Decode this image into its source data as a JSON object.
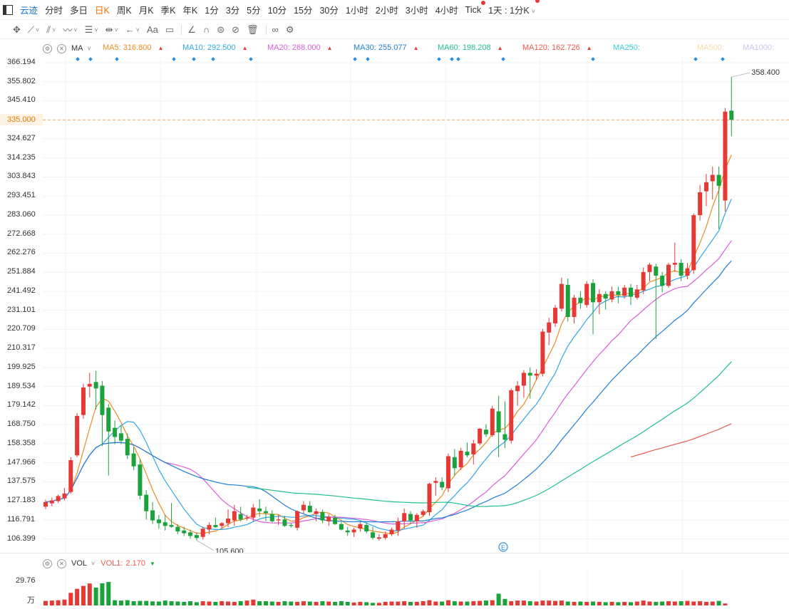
{
  "topbar": {
    "periods": [
      "云迹",
      "分时",
      "多日",
      "日K",
      "周K",
      "月K",
      "季K",
      "年K",
      "1分",
      "3分",
      "5分",
      "10分",
      "15分",
      "30分",
      "1小时",
      "2小时",
      "3小时",
      "4小时",
      "Tick",
      "1天 : 1分K"
    ],
    "active": "日K",
    "dotted": [
      "Tick",
      "1天 : 1分K"
    ]
  },
  "toolbar": {
    "tools": [
      "crosshair-icon",
      "line-icon",
      "channel-icon",
      "wave-icon",
      "fib-icon",
      "measure-icon",
      "arrow-icon",
      "text-icon",
      "comment-icon",
      "angle-icon",
      "magnet-icon",
      "hide-icon",
      "lock-icon",
      "delete-icon",
      "link-icon",
      "settings-icon"
    ],
    "text_label": "Aa"
  },
  "ma_legend": {
    "name": "MA",
    "items": [
      {
        "label": "MA5:",
        "value": "316.800",
        "color": "#f08a24",
        "trend": "up"
      },
      {
        "label": "MA10:",
        "value": "292.500",
        "color": "#2fa8e8",
        "trend": "up"
      },
      {
        "label": "MA20:",
        "value": "268.000",
        "color": "#d95ed9",
        "trend": "up"
      },
      {
        "label": "MA30:",
        "value": "255.077",
        "color": "#1e7fd9",
        "trend": "up"
      },
      {
        "label": "MA60:",
        "value": "198.208",
        "color": "#1fbf8f",
        "trend": "up"
      },
      {
        "label": "MA120:",
        "value": "162.726",
        "color": "#e85a4f",
        "trend": "up"
      },
      {
        "label": "MA250:",
        "value": "",
        "color": "#34d1e0",
        "trend": ""
      },
      {
        "label": "MA500:",
        "value": "",
        "color": "#f5d9a8",
        "trend": ""
      },
      {
        "label": "MA1000:",
        "value": "",
        "color": "#c9c3f0",
        "trend": ""
      }
    ]
  },
  "y_axis_labels": [
    "366.194",
    "355.802",
    "345.410",
    "335.000",
    "324.627",
    "314.235",
    "303.843",
    "293.451",
    "283.060",
    "272.668",
    "262.276",
    "251.884",
    "241.492",
    "231.101",
    "220.709",
    "210.317",
    "199.925",
    "189.534",
    "179.142",
    "168.750",
    "158.358",
    "147.966",
    "137.575",
    "127.183",
    "116.791",
    "106.399"
  ],
  "current_price_tag": "335.000",
  "max_label": "358.400",
  "min_label": "105.600",
  "event_marker": "E",
  "vol_legend": {
    "name": "VOL",
    "item": "VOL1:",
    "value": "2.170",
    "color": "#e85a4f",
    "trend": "down"
  },
  "vol_axis": {
    "top": "29.76",
    "unit": "万"
  },
  "colors": {
    "up": "#e53935",
    "down": "#1aa33a",
    "accent": "#ff6a00"
  },
  "chart_data": {
    "type": "candlestick",
    "y_range": [
      101.2,
      366.194
    ],
    "ohlc": [
      [
        124.0,
        127.8,
        122.5,
        126.5
      ],
      [
        125.8,
        129.0,
        124.2,
        127.4
      ],
      [
        127.0,
        130.6,
        125.9,
        129.8
      ],
      [
        128.5,
        134.2,
        127.5,
        131.2
      ],
      [
        132.0,
        151.0,
        131.0,
        149.4
      ],
      [
        152.0,
        175.0,
        151.0,
        173.5
      ],
      [
        174.0,
        191.0,
        172.0,
        189.0
      ],
      [
        189.5,
        197.0,
        183.5,
        191.0
      ],
      [
        192.0,
        198.0,
        177.0,
        188.5
      ],
      [
        190.0,
        192.5,
        157.0,
        174.0
      ],
      [
        178.0,
        180.0,
        141.0,
        165.0
      ],
      [
        167.0,
        171.0,
        158.0,
        162.0
      ],
      [
        164.0,
        168.5,
        158.0,
        160.0
      ],
      [
        161.0,
        164.0,
        150.0,
        152.0
      ],
      [
        153.0,
        156.5,
        144.0,
        146.0
      ],
      [
        147.0,
        150.0,
        128.0,
        130.0
      ],
      [
        130.5,
        133.0,
        117.0,
        121.5
      ],
      [
        122.0,
        126.5,
        114.5,
        116.5
      ],
      [
        117.0,
        119.5,
        112.0,
        115.0
      ],
      [
        115.5,
        119.5,
        111.0,
        113.5
      ],
      [
        114.0,
        126.0,
        112.5,
        113.0
      ],
      [
        113.0,
        114.5,
        109.0,
        110.5
      ],
      [
        111.0,
        113.0,
        108.0,
        109.5
      ],
      [
        110.0,
        111.5,
        106.5,
        108.0
      ],
      [
        108.5,
        110.0,
        105.6,
        106.9
      ],
      [
        107.5,
        113.0,
        106.0,
        112.0
      ],
      [
        111.5,
        115.5,
        109.0,
        114.0
      ],
      [
        114.0,
        118.0,
        112.5,
        112.8
      ],
      [
        113.5,
        115.5,
        112.0,
        115.0
      ],
      [
        115.0,
        122.5,
        112.8,
        117.5
      ],
      [
        116.5,
        125.0,
        113.5,
        121.5
      ],
      [
        120.0,
        124.0,
        116.0,
        117.0
      ],
      [
        117.5,
        119.5,
        116.5,
        118.0
      ],
      [
        118.0,
        125.5,
        116.0,
        123.5
      ],
      [
        123.0,
        128.0,
        118.5,
        121.5
      ],
      [
        121.5,
        124.0,
        116.0,
        120.5
      ],
      [
        120.0,
        122.0,
        115.5,
        116.0
      ],
      [
        116.5,
        119.5,
        114.0,
        117.0
      ],
      [
        117.0,
        119.0,
        113.0,
        113.5
      ],
      [
        114.0,
        115.0,
        112.5,
        113.5
      ],
      [
        112.5,
        122.0,
        111.0,
        121.5
      ],
      [
        122.0,
        127.0,
        120.0,
        125.0
      ],
      [
        124.5,
        127.0,
        120.5,
        121.0
      ],
      [
        120.0,
        123.0,
        116.0,
        121.5
      ],
      [
        121.0,
        122.5,
        115.0,
        116.5
      ],
      [
        116.0,
        120.0,
        113.5,
        118.5
      ],
      [
        118.0,
        119.5,
        114.0,
        114.5
      ],
      [
        114.5,
        115.5,
        111.0,
        111.5
      ],
      [
        111.0,
        113.0,
        108.0,
        110.0
      ],
      [
        110.0,
        112.5,
        107.5,
        111.5
      ],
      [
        112.0,
        115.5,
        110.5,
        114.5
      ],
      [
        114.0,
        115.5,
        109.5,
        110.5
      ],
      [
        110.0,
        113.0,
        106.0,
        107.0
      ],
      [
        106.5,
        109.0,
        105.5,
        107.3
      ],
      [
        107.0,
        110.5,
        106.0,
        109.0
      ],
      [
        109.0,
        112.5,
        108.0,
        111.5
      ],
      [
        111.0,
        118.0,
        108.0,
        116.0
      ],
      [
        116.0,
        123.0,
        112.0,
        120.5
      ],
      [
        120.0,
        121.5,
        114.5,
        116.5
      ],
      [
        116.0,
        120.5,
        112.5,
        119.5
      ],
      [
        119.5,
        122.5,
        118.5,
        121.5
      ],
      [
        121.0,
        137.0,
        119.0,
        136.5
      ],
      [
        137.0,
        140.0,
        130.0,
        138.0
      ],
      [
        137.5,
        140.0,
        133.0,
        134.5
      ],
      [
        134.0,
        153.0,
        132.0,
        151.5
      ],
      [
        151.0,
        155.5,
        141.0,
        145.0
      ],
      [
        145.5,
        156.0,
        144.0,
        154.5
      ],
      [
        154.0,
        159.0,
        151.0,
        152.0
      ],
      [
        152.5,
        160.5,
        147.0,
        158.5
      ],
      [
        158.5,
        167.0,
        157.5,
        166.5
      ],
      [
        166.0,
        169.0,
        162.0,
        163.5
      ],
      [
        163.0,
        179.0,
        162.0,
        177.5
      ],
      [
        176.0,
        184.5,
        151.0,
        164.5
      ],
      [
        163.5,
        181.5,
        156.0,
        160.5
      ],
      [
        160.0,
        188.5,
        158.5,
        187.5
      ],
      [
        187.0,
        192.5,
        179.0,
        190.0
      ],
      [
        190.0,
        198.5,
        183.5,
        197.0
      ],
      [
        197.0,
        200.0,
        183.0,
        195.5
      ],
      [
        195.5,
        199.0,
        193.0,
        196.5
      ],
      [
        196.5,
        221.0,
        195.0,
        219.5
      ],
      [
        219.0,
        227.0,
        212.0,
        224.5
      ],
      [
        224.0,
        234.0,
        222.0,
        232.5
      ],
      [
        232.0,
        249.0,
        230.5,
        245.5
      ],
      [
        245.0,
        248.5,
        225.0,
        227.5
      ],
      [
        227.5,
        239.5,
        224.0,
        238.0
      ],
      [
        238.0,
        241.5,
        232.0,
        235.0
      ],
      [
        234.0,
        247.0,
        232.5,
        245.5
      ],
      [
        246.0,
        248.0,
        218.0,
        235.5
      ],
      [
        235.5,
        242.5,
        229.0,
        240.0
      ],
      [
        240.0,
        241.5,
        231.5,
        237.5
      ],
      [
        237.0,
        244.0,
        235.5,
        241.5
      ],
      [
        241.5,
        244.0,
        235.0,
        239.5
      ],
      [
        239.0,
        245.0,
        237.5,
        243.5
      ],
      [
        243.5,
        245.5,
        234.0,
        238.5
      ],
      [
        238.0,
        245.0,
        237.0,
        242.5
      ],
      [
        242.0,
        254.5,
        240.0,
        252.0
      ],
      [
        252.0,
        257.0,
        247.0,
        256.0
      ],
      [
        255.0,
        256.5,
        215.5,
        250.0
      ],
      [
        250.0,
        252.0,
        241.0,
        244.5
      ],
      [
        244.5,
        257.0,
        243.5,
        256.0
      ],
      [
        256.0,
        268.0,
        252.0,
        257.0
      ],
      [
        257.0,
        259.0,
        247.0,
        250.0
      ],
      [
        250.0,
        257.0,
        248.0,
        254.0
      ],
      [
        253.0,
        284.0,
        251.0,
        283.0
      ],
      [
        283.0,
        299.5,
        280.0,
        295.5
      ],
      [
        296.0,
        305.5,
        288.0,
        301.0
      ],
      [
        301.5,
        309.5,
        291.5,
        305.0
      ],
      [
        305.0,
        309.5,
        275.5,
        299.0
      ],
      [
        291.0,
        341.5,
        285.0,
        339.5
      ],
      [
        340.0,
        358.4,
        326.0,
        335.0
      ]
    ],
    "volume": [
      5.6,
      6.0,
      6.4,
      7.2,
      15.5,
      20.4,
      24.0,
      27.0,
      22.0,
      27.2,
      28.8,
      6.4,
      6.0,
      6.5,
      5.2,
      5.6,
      5.6,
      5.0,
      4.8,
      6.0,
      5.2,
      4.8,
      4.4,
      5.2,
      4.0,
      5.2,
      4.8,
      4.4,
      5.2,
      4.8,
      4.4,
      5.2,
      6.0,
      7.2,
      5.2,
      5.2,
      4.8,
      4.4,
      5.2,
      4.8,
      4.4,
      5.2,
      4.8,
      4.4,
      5.2,
      4.8,
      4.4,
      5.2,
      4.4,
      3.6,
      4.4,
      4.0,
      3.2,
      3.2,
      4.4,
      4.8,
      4.8,
      5.2,
      4.4,
      4.4,
      5.2,
      6.4,
      4.8,
      4.8,
      6.4,
      5.2,
      4.8,
      4.8,
      5.2,
      5.6,
      6.0,
      6.4,
      14.4,
      8.0,
      5.2,
      6.0,
      6.0,
      5.2,
      4.8,
      6.0,
      6.0,
      5.6,
      6.0,
      4.8,
      4.4,
      4.8,
      4.4,
      4.8,
      4.4,
      4.0,
      4.4,
      4.0,
      4.4,
      4.0,
      4.8,
      6.0,
      4.8,
      4.4,
      4.8,
      5.2,
      4.8,
      5.2,
      5.6,
      4.8,
      5.2,
      4.4,
      4.8,
      5.6,
      2.4
    ],
    "ma_series_names": [
      "MA5",
      "MA10",
      "MA20",
      "MA30",
      "MA60",
      "MA120"
    ]
  }
}
